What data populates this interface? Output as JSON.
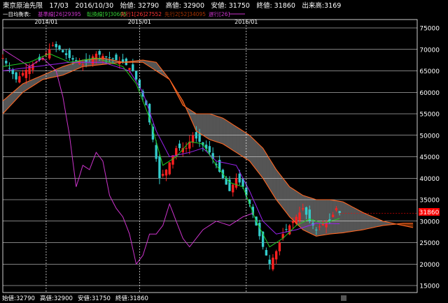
{
  "header": {
    "line1": "東京原油先限　17/03　2016/10/30　始値: 32790　高値: 32900　安値: 31750　終値: 31860　出来高:3169",
    "ichimoku_label": "一目均衡表:",
    "legend": [
      {
        "label": "基準線[26]29395",
        "color": "#cc33cc"
      },
      {
        "label": "転換線[9]30605",
        "color": "#33cc33"
      },
      {
        "label": "先行1[26]27552",
        "color": "#ff3333"
      },
      {
        "label": "先行2[52]34095",
        "color": "#aa3300"
      },
      {
        "label": "遅行[26]",
        "color": "#cc33cc"
      }
    ]
  },
  "footer": {
    "open": "始値:32790",
    "high": "高値:32900",
    "low": "安値:31750",
    "close": "終値:31860"
  },
  "price_tag": "31860",
  "colors": {
    "background": "#000000",
    "grid": "#ffffff",
    "candle_up": "#ff2020",
    "candle_down": "#33cccc",
    "kijun": "#9922ee",
    "tenkan": "#22cc22",
    "chikou": "#cc33cc",
    "cloud_line": "#ff6622",
    "cloud_bull": "#6b2a05",
    "cloud_bear": "#555555",
    "price_tag": "#ff0000"
  },
  "chart_data": {
    "type": "candlestick",
    "title": "東京原油先限",
    "y_axis": {
      "ticks": [
        "75000",
        "70000",
        "65000",
        "60000",
        "55000",
        "50000",
        "45000",
        "40000",
        "35000",
        "30000",
        "25000",
        "20000",
        "15000"
      ],
      "ylim": [
        15000,
        75000
      ]
    },
    "x_axis": {
      "date_labels": [
        "2014/01",
        "2015/01",
        "2016/01"
      ]
    },
    "n_periods": 124,
    "close_series": [
      {
        "i": 0,
        "v": 68000
      },
      {
        "i": 4,
        "v": 63000
      },
      {
        "i": 8,
        "v": 66000
      },
      {
        "i": 12,
        "v": 68000
      },
      {
        "i": 15,
        "v": 71000
      },
      {
        "i": 17,
        "v": 70000
      },
      {
        "i": 20,
        "v": 68000
      },
      {
        "i": 24,
        "v": 66500
      },
      {
        "i": 28,
        "v": 69000
      },
      {
        "i": 32,
        "v": 68000
      },
      {
        "i": 36,
        "v": 67000
      },
      {
        "i": 39,
        "v": 65000
      },
      {
        "i": 41,
        "v": 61000
      },
      {
        "i": 43,
        "v": 57000
      },
      {
        "i": 45,
        "v": 49000
      },
      {
        "i": 47,
        "v": 40000
      },
      {
        "i": 49,
        "v": 42000
      },
      {
        "i": 52,
        "v": 47000
      },
      {
        "i": 55,
        "v": 47000
      },
      {
        "i": 57,
        "v": 50000
      },
      {
        "i": 59,
        "v": 48500
      },
      {
        "i": 62,
        "v": 46000
      },
      {
        "i": 64,
        "v": 43000
      },
      {
        "i": 66,
        "v": 40000
      },
      {
        "i": 68,
        "v": 37000
      },
      {
        "i": 70,
        "v": 40000
      },
      {
        "i": 72,
        "v": 38000
      },
      {
        "i": 74,
        "v": 34000
      },
      {
        "i": 76,
        "v": 29000
      },
      {
        "i": 78,
        "v": 24000
      },
      {
        "i": 80,
        "v": 20000
      },
      {
        "i": 82,
        "v": 23000
      },
      {
        "i": 84,
        "v": 27000
      },
      {
        "i": 87,
        "v": 30000
      },
      {
        "i": 90,
        "v": 33000
      },
      {
        "i": 92,
        "v": 30000
      },
      {
        "i": 94,
        "v": 28000
      },
      {
        "i": 96,
        "v": 29500
      },
      {
        "i": 98,
        "v": 30000
      },
      {
        "i": 100,
        "v": 33000
      },
      {
        "i": 101,
        "v": 31860
      }
    ],
    "kijun_series": [
      {
        "i": 0,
        "v": 65000
      },
      {
        "i": 10,
        "v": 66000
      },
      {
        "i": 20,
        "v": 67000
      },
      {
        "i": 30,
        "v": 67000
      },
      {
        "i": 38,
        "v": 65000
      },
      {
        "i": 42,
        "v": 60000
      },
      {
        "i": 46,
        "v": 51000
      },
      {
        "i": 50,
        "v": 45000
      },
      {
        "i": 56,
        "v": 46000
      },
      {
        "i": 60,
        "v": 47000
      },
      {
        "i": 64,
        "v": 44000
      },
      {
        "i": 70,
        "v": 43000
      },
      {
        "i": 74,
        "v": 37000
      },
      {
        "i": 78,
        "v": 30000
      },
      {
        "i": 82,
        "v": 27000
      },
      {
        "i": 88,
        "v": 28000
      },
      {
        "i": 94,
        "v": 29500
      },
      {
        "i": 101,
        "v": 29395
      }
    ],
    "tenkan_series": [
      {
        "i": 0,
        "v": 66000
      },
      {
        "i": 8,
        "v": 67000
      },
      {
        "i": 14,
        "v": 69000
      },
      {
        "i": 20,
        "v": 67000
      },
      {
        "i": 28,
        "v": 68000
      },
      {
        "i": 36,
        "v": 66000
      },
      {
        "i": 40,
        "v": 62000
      },
      {
        "i": 44,
        "v": 54000
      },
      {
        "i": 48,
        "v": 43000
      },
      {
        "i": 52,
        "v": 45000
      },
      {
        "i": 56,
        "v": 48500
      },
      {
        "i": 60,
        "v": 48000
      },
      {
        "i": 64,
        "v": 43000
      },
      {
        "i": 68,
        "v": 39000
      },
      {
        "i": 72,
        "v": 38000
      },
      {
        "i": 76,
        "v": 30000
      },
      {
        "i": 80,
        "v": 24000
      },
      {
        "i": 84,
        "v": 26000
      },
      {
        "i": 88,
        "v": 29000
      },
      {
        "i": 92,
        "v": 30500
      },
      {
        "i": 96,
        "v": 29500
      },
      {
        "i": 101,
        "v": 30605
      }
    ],
    "chikou_series": [
      {
        "i": 0,
        "v": 70000
      },
      {
        "i": 4,
        "v": 68000
      },
      {
        "i": 8,
        "v": 66000
      },
      {
        "i": 12,
        "v": 68000
      },
      {
        "i": 16,
        "v": 65000
      },
      {
        "i": 18,
        "v": 59000
      },
      {
        "i": 20,
        "v": 50000
      },
      {
        "i": 22,
        "v": 38000
      },
      {
        "i": 24,
        "v": 43000
      },
      {
        "i": 26,
        "v": 42000
      },
      {
        "i": 28,
        "v": 46000
      },
      {
        "i": 30,
        "v": 44000
      },
      {
        "i": 32,
        "v": 36000
      },
      {
        "i": 34,
        "v": 33000
      },
      {
        "i": 36,
        "v": 31000
      },
      {
        "i": 38,
        "v": 27000
      },
      {
        "i": 40,
        "v": 20000
      },
      {
        "i": 42,
        "v": 22000
      },
      {
        "i": 44,
        "v": 27000
      },
      {
        "i": 46,
        "v": 27000
      },
      {
        "i": 48,
        "v": 29000
      },
      {
        "i": 50,
        "v": 34000
      },
      {
        "i": 52,
        "v": 30000
      },
      {
        "i": 54,
        "v": 26000
      },
      {
        "i": 56,
        "v": 24000
      },
      {
        "i": 60,
        "v": 28000
      },
      {
        "i": 64,
        "v": 30000
      },
      {
        "i": 68,
        "v": 29000
      },
      {
        "i": 72,
        "v": 31000
      },
      {
        "i": 75,
        "v": 31860
      }
    ],
    "senkou_a_series": [
      {
        "i": 0,
        "v": 55000
      },
      {
        "i": 6,
        "v": 60000
      },
      {
        "i": 12,
        "v": 63000
      },
      {
        "i": 18,
        "v": 64000
      },
      {
        "i": 24,
        "v": 66000
      },
      {
        "i": 30,
        "v": 66500
      },
      {
        "i": 36,
        "v": 67000
      },
      {
        "i": 42,
        "v": 67000
      },
      {
        "i": 46,
        "v": 65000
      },
      {
        "i": 50,
        "v": 63000
      },
      {
        "i": 54,
        "v": 58000
      },
      {
        "i": 58,
        "v": 51000
      },
      {
        "i": 62,
        "v": 49000
      },
      {
        "i": 66,
        "v": 48000
      },
      {
        "i": 70,
        "v": 46000
      },
      {
        "i": 74,
        "v": 44000
      },
      {
        "i": 78,
        "v": 40000
      },
      {
        "i": 82,
        "v": 35000
      },
      {
        "i": 86,
        "v": 31000
      },
      {
        "i": 90,
        "v": 28000
      },
      {
        "i": 94,
        "v": 26500
      },
      {
        "i": 98,
        "v": 27000
      },
      {
        "i": 102,
        "v": 27300
      },
      {
        "i": 108,
        "v": 28000
      },
      {
        "i": 114,
        "v": 29000
      },
      {
        "i": 120,
        "v": 29500
      },
      {
        "i": 123,
        "v": 29500
      }
    ],
    "senkou_b_series": [
      {
        "i": 0,
        "v": 58000
      },
      {
        "i": 6,
        "v": 62000
      },
      {
        "i": 12,
        "v": 64000
      },
      {
        "i": 18,
        "v": 66000
      },
      {
        "i": 24,
        "v": 67500
      },
      {
        "i": 30,
        "v": 68000
      },
      {
        "i": 36,
        "v": 67000
      },
      {
        "i": 42,
        "v": 67500
      },
      {
        "i": 46,
        "v": 67000
      },
      {
        "i": 50,
        "v": 63000
      },
      {
        "i": 54,
        "v": 57000
      },
      {
        "i": 58,
        "v": 55000
      },
      {
        "i": 62,
        "v": 55000
      },
      {
        "i": 66,
        "v": 54000
      },
      {
        "i": 70,
        "v": 52000
      },
      {
        "i": 74,
        "v": 50000
      },
      {
        "i": 78,
        "v": 47000
      },
      {
        "i": 82,
        "v": 42000
      },
      {
        "i": 86,
        "v": 38000
      },
      {
        "i": 90,
        "v": 36000
      },
      {
        "i": 94,
        "v": 35000
      },
      {
        "i": 98,
        "v": 35000
      },
      {
        "i": 102,
        "v": 34500
      },
      {
        "i": 108,
        "v": 32000
      },
      {
        "i": 114,
        "v": 30000
      },
      {
        "i": 120,
        "v": 29000
      },
      {
        "i": 123,
        "v": 28500
      }
    ],
    "last_close": 31860
  }
}
